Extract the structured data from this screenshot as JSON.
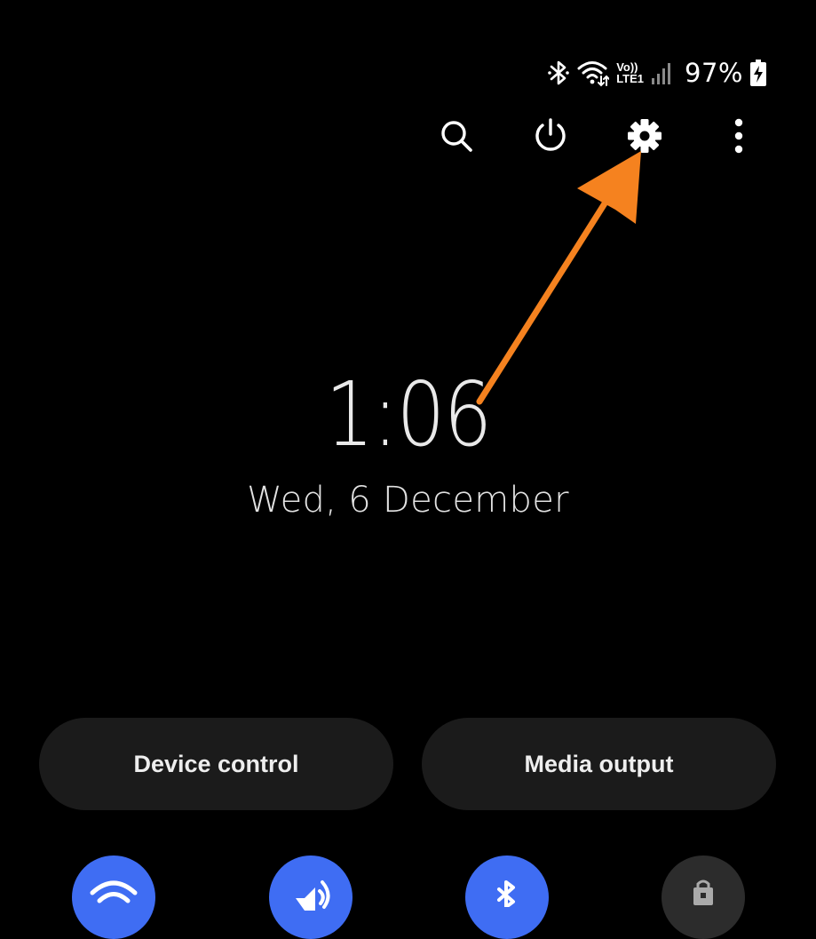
{
  "status_bar": {
    "icons": [
      "bluetooth-icon",
      "wifi-icon",
      "volte-lte-icon",
      "signal-icon",
      "battery-charging-icon"
    ],
    "volte_label_top": "Vo))",
    "volte_label_bottom": "LTE1",
    "battery_percent": "97%"
  },
  "top_actions": [
    {
      "icon": "search-icon"
    },
    {
      "icon": "power-icon"
    },
    {
      "icon": "gear-icon"
    },
    {
      "icon": "more-vert-icon"
    }
  ],
  "clock": {
    "time": "1:06",
    "date": "Wed, 6 December"
  },
  "buttons": {
    "device_control": "Device control",
    "media_output": "Media output"
  },
  "quick_tiles": [
    {
      "icon": "wifi-icon",
      "active": true
    },
    {
      "icon": "sound-icon",
      "active": true
    },
    {
      "icon": "bluetooth-icon",
      "active": true
    },
    {
      "icon": "lock-rotation-icon",
      "active": false
    }
  ],
  "colors": {
    "background": "#000000",
    "accent_blue": "#3f6df3",
    "tile_inactive": "#2c2c2c",
    "pill_bg": "#1b1b1b",
    "annotation_arrow": "#f5821f"
  }
}
